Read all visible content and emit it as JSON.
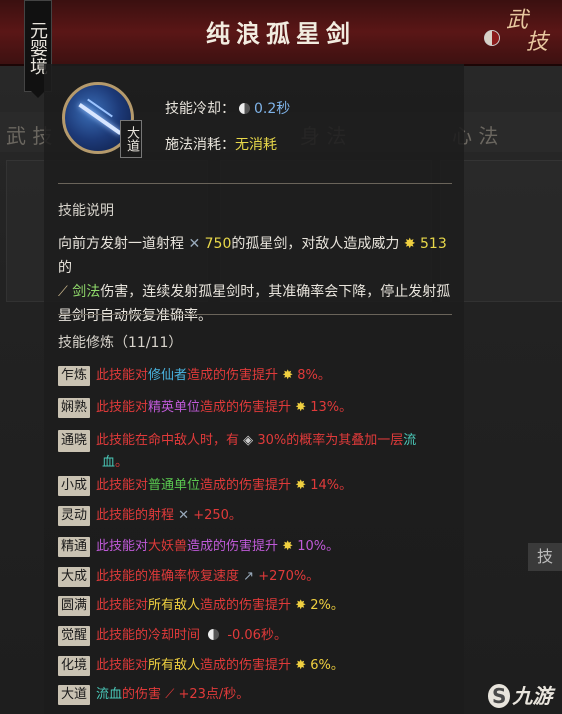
{
  "header": {
    "title": "纯浪孤星剑",
    "realm": "元婴境",
    "stamp": [
      "武",
      "技"
    ]
  },
  "skill": {
    "badge": "大道",
    "cooldown_label": "技能冷却：",
    "cooldown_value": "0.2秒",
    "cost_label": "施法消耗：",
    "cost_value": "无消耗"
  },
  "description": {
    "title": "技能说明",
    "p1": "向前方发射一道射程",
    "range": "750",
    "p2": "的孤星剑，对敌人造成威力",
    "power": "513",
    "p3": "的",
    "type": "剑法",
    "p4": "伤害，连续发射孤星剑时，其准确率会下降，停止发射孤星剑可自动恢复准确率。"
  },
  "training": {
    "title": "技能修炼（11/11）",
    "rows": [
      {
        "tag": "乍炼",
        "a": "此技能对",
        "b": "修仙者",
        "c": "造成的伤害提升",
        "v": "8%。",
        "bcolor": "blue"
      },
      {
        "tag": "娴熟",
        "a": "此技能对",
        "b": "精英单位",
        "c": "造成的伤害提升",
        "v": "13%。",
        "bcolor": "purple"
      },
      {
        "tag": "通晓",
        "a": "此技能在命中敌人时，有",
        "b": "30%的概率为其叠加一层",
        "c": "流",
        "d": "血",
        "v": "。"
      },
      {
        "tag": "小成",
        "a": "此技能对",
        "b": "普通单位",
        "c": "造成的伤害提升",
        "v": "14%。",
        "bcolor": "green"
      },
      {
        "tag": "灵动",
        "a": "此技能的射程",
        "v": "+250。"
      },
      {
        "tag": "精通",
        "a": "此技能对",
        "b": "大妖兽",
        "c": "造成的伤害提升",
        "v": "10%。",
        "bcolor": "red"
      },
      {
        "tag": "大成",
        "a": "此技能的准确率恢复速度",
        "v": "+270%。"
      },
      {
        "tag": "圆满",
        "a": "此技能对",
        "b": "所有敌人",
        "c": "造成的伤害提升",
        "v": "2%。",
        "bcolor": "gold"
      },
      {
        "tag": "觉醒",
        "a": "此技能的冷却时间",
        "v": "-0.06秒。"
      },
      {
        "tag": "化境",
        "a": "此技能对",
        "b": "所有敌人",
        "c": "造成的伤害提升",
        "v": "6%。",
        "bcolor": "gold"
      },
      {
        "tag": "大道",
        "a": "流血",
        "b": "的伤害",
        "v": "+23点/秒。"
      }
    ]
  },
  "background": {
    "tab1": "武 技",
    "tab2": "身 法",
    "tab3": "心 法",
    "right_tag": "技"
  },
  "watermark": "九游"
}
